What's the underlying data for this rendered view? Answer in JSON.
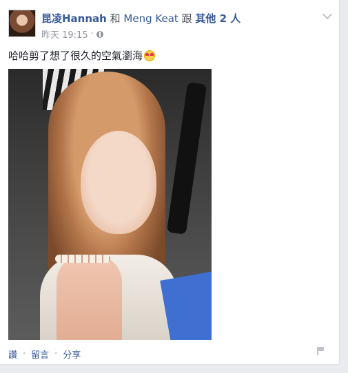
{
  "post": {
    "author": "昆凌Hannah",
    "and_text": "和",
    "tagged_person": "Meng Keat",
    "with_text": "跟",
    "others": "其他 2 人",
    "timestamp": "昨天 19:15",
    "separator": "·",
    "text": "哈哈剪了想了很久的空氣瀏海"
  },
  "actions": {
    "like": "讚",
    "comment": "留言",
    "share": "分享",
    "separator": "·"
  },
  "icons": {
    "avatar": "profile-photo",
    "globe": "globe-icon",
    "chevron": "chevron-down-icon",
    "emoji": "heart-eyes-emoji",
    "flag": "flag-icon"
  }
}
